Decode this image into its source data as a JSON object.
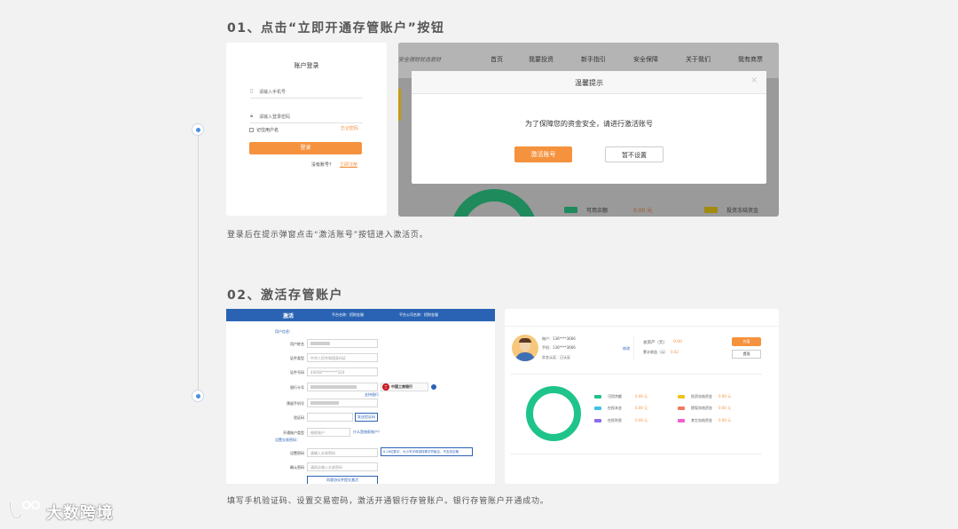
{
  "step1": {
    "title": "01、点击“立即开通存管账户”按钮",
    "caption": "登录后在提示弹窗点击“激活账号”按钮进入激活页。",
    "login": {
      "title": "账户登录",
      "phone_placeholder": "请输入手机号",
      "password_placeholder": "请输入登录密码",
      "remember": "记住用户名",
      "forgot": "忘记密码",
      "login_button": "登录",
      "no_account": "没有账号？",
      "register": "立即注册"
    },
    "site": {
      "slogan": "安全理财就选君财",
      "nav": [
        "首页",
        "我要投资",
        "新手指引",
        "安全保障",
        "关于我们",
        "我有商票"
      ],
      "legend": [
        {
          "label": "可用余额",
          "value": "0.00 元",
          "color": "#1fc48a"
        },
        {
          "label": "投资冻结资金",
          "value": "",
          "color": "#f2c317"
        }
      ]
    },
    "dialog": {
      "title": "温馨提示",
      "message": "为了保障您的资金安全，请进行激活账号",
      "activate_button": "激活账号",
      "skip_button": "暂不设置",
      "close": "×"
    }
  },
  "step2": {
    "title": "02、激活存管账户",
    "caption": "填写手机验证码、设置交易密码，激活开通银行存管账户。银行存管账户开通成功。",
    "form": {
      "header_title": "激活",
      "header_tab1": "平台名称：招财金服",
      "header_tab2": "平台公司名称：招财金服",
      "section_user": "用户信息：",
      "fields": [
        {
          "label": "用户姓名",
          "value": ""
        },
        {
          "label": "证件类型",
          "value": "中华人民共和国身份证"
        },
        {
          "label": "证件号码",
          "value": "44058*********310"
        },
        {
          "label": "银行卡号",
          "value": ""
        },
        {
          "label": "预留手机号",
          "value": ""
        },
        {
          "label": "验证码",
          "value": ""
        }
      ],
      "bank_name": "中国工商银行",
      "supported_banks": "支持银行",
      "send_code": "发送验证码",
      "account_type_label": "开通账户类型",
      "account_type_value": "借款账户",
      "account_type_help": "什么是借款账户？",
      "section_password": "设置交易密码：",
      "set_password_label": "设置密码",
      "set_password_placeholder": "请输入交易密码",
      "password_tip": "6-16位数字、大小写字母或特殊字符组合，不支持空格",
      "confirm_password_label": "确认密码",
      "confirm_password_placeholder": "请再次输入交易密码",
      "submit": "同意协议并提交激活"
    },
    "account": {
      "account_line": "账户：136****3666",
      "phone_line": "手机：136****3666",
      "auth_line": "实名认证：已认证",
      "edit": "修改",
      "total_assets": "总资产（元）",
      "total_assets_value": "0.00",
      "accumulated": "累计收益（元）",
      "accumulated_value": "0.62",
      "recharge": "充值",
      "withdraw": "提现",
      "legend": [
        {
          "label": "可用余额",
          "value": "0.00 元",
          "color": "#1fc48a"
        },
        {
          "label": "在投本金",
          "value": "0.00 元",
          "color": "#3ec3e6"
        },
        {
          "label": "在投利息",
          "value": "0.00 元",
          "color": "#8c6ee6"
        },
        {
          "label": "投资冻结资金",
          "value": "0.00 元",
          "color": "#f2c317"
        },
        {
          "label": "提现冻结资金",
          "value": "0.00 元",
          "color": "#ef7b5c"
        },
        {
          "label": "其它冻结资金",
          "value": "0.00 元",
          "color": "#ef5fd0"
        }
      ]
    }
  },
  "watermark": "大数跨境"
}
